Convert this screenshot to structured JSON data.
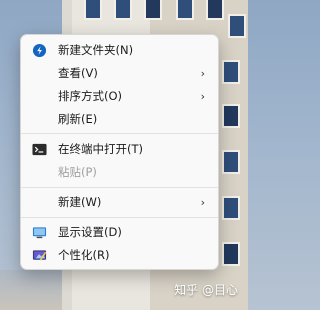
{
  "menu": {
    "items": {
      "new_folder": {
        "label": "新建文件夹(N)"
      },
      "view": {
        "label": "查看(V)"
      },
      "sort": {
        "label": "排序方式(O)"
      },
      "refresh": {
        "label": "刷新(E)"
      },
      "terminal": {
        "label": "在终端中打开(T)"
      },
      "paste": {
        "label": "粘贴(P)"
      },
      "new": {
        "label": "新建(W)"
      },
      "display": {
        "label": "显示设置(D)"
      },
      "personalize": {
        "label": "个性化(R)"
      }
    },
    "submenu_arrow": "›"
  },
  "watermark": "知乎 @目心",
  "colors": {
    "menu_background": "#f9f9f9",
    "disabled_text": "#a0a0a0",
    "accent": "#1565c0"
  }
}
